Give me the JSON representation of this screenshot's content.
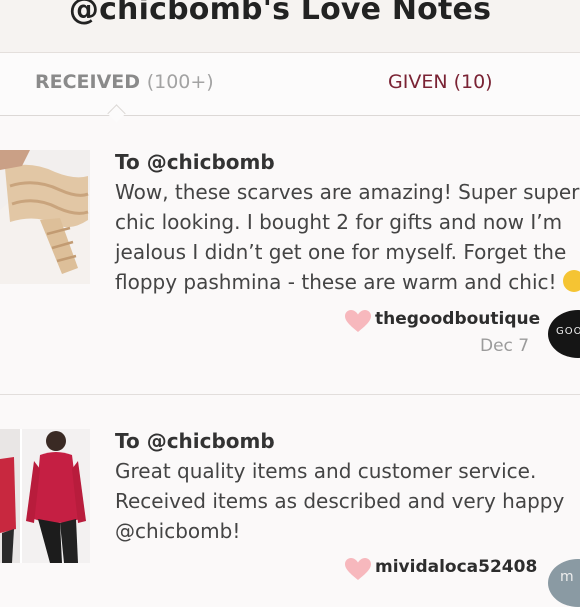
{
  "header": {
    "title": "@chicbomb's Love Notes"
  },
  "tabs": {
    "received_label": "RECEIVED",
    "received_count": "(100+)",
    "given_label": "GIVEN (10)"
  },
  "notes": [
    {
      "to": "To @chicbomb",
      "lines": [
        "Wow, these scarves are amazing! Super super",
        "chic looking. I bought 2 for gifts and now I’m",
        "jealous I didn’t get one for myself. Forget the",
        "floppy pashmina - these are warm and chic!"
      ],
      "sender": "thegoodboutique",
      "date": "Dec 7",
      "avatar_text": "GOO"
    },
    {
      "to": "To @chicbomb",
      "lines": [
        "Great quality items and customer service.",
        "Received items as described and very happy",
        "@chicbomb!"
      ],
      "sender": "mividaloca52408",
      "avatar_text": "m"
    }
  ],
  "colors": {
    "accent": "#7a2334",
    "heart": "#f7b8bd",
    "tab_inactive": "#8a8a8a"
  },
  "icons": [
    "heart-icon",
    "emoji-icon",
    "caret-up-icon"
  ]
}
